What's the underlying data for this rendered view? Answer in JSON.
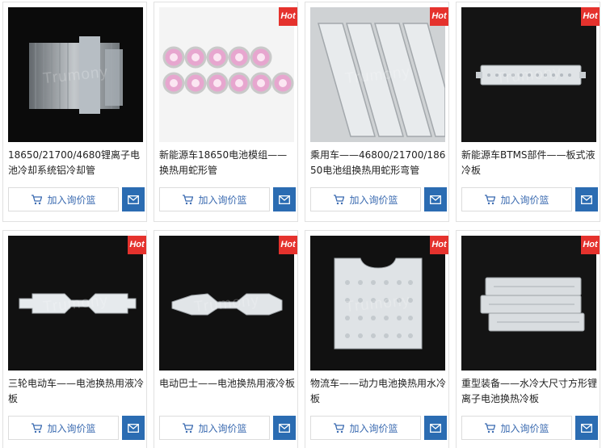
{
  "brand_watermark": "Trumony",
  "hot_badge": "Hot",
  "cart_button_label": "加入询价篮",
  "products": [
    {
      "title": "18650/21700/4680锂离子电池冷却系统铝冷却管",
      "hot": false,
      "image": "aluminum-cooling-tubes"
    },
    {
      "title": "新能源车18650电池模组——换热用蛇形管",
      "hot": true,
      "image": "serpentine-tube-pink-cells"
    },
    {
      "title": "乘用车——46800/21700/18650电池组换热用蛇形弯管",
      "hot": true,
      "image": "serpentine-bent-tube"
    },
    {
      "title": "新能源车BTMS部件——板式液冷板",
      "hot": true,
      "image": "plate-liquid-cold-plate"
    },
    {
      "title": "三轮电动车——电池换热用液冷板",
      "hot": true,
      "image": "narrow-cold-plate"
    },
    {
      "title": "电动巴士——电池换热用液冷板",
      "hot": true,
      "image": "long-cold-plate"
    },
    {
      "title": "物流车——动力电池换热用水冷板",
      "hot": true,
      "image": "stamped-cold-plate"
    },
    {
      "title": "重型装备——水冷大尺寸方形锂离子电池换热冷板",
      "hot": true,
      "image": "stacked-cold-plates"
    }
  ],
  "colors": {
    "hot_badge": "#e5322d",
    "mail_button": "#2b6cb2",
    "link_text": "#3a6ab0"
  }
}
